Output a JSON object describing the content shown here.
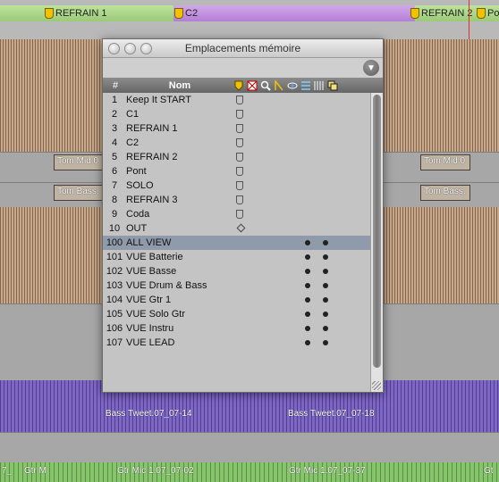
{
  "ruler": {
    "markers": [
      "REFRAIN 1",
      "C2",
      "REFRAIN 2",
      "Pon"
    ]
  },
  "tracks": {
    "clips": [
      "Tom Mid.0",
      "Tom Mid.0",
      "Tom Bass.",
      "Tom Bass."
    ],
    "bass_labels": [
      "Bass Tweet.07_07-14",
      "Bass Tweet.07_07-18"
    ],
    "gtr_labels": [
      "7_",
      "Gtr M",
      "Gtr Mic 1.07_07-02",
      "Gtr Mic 1.07_07-37",
      "Gt"
    ]
  },
  "window": {
    "title": "Emplacements mémoire",
    "columns": {
      "num": "#",
      "name": "Nom"
    },
    "memories": [
      {
        "num": "1",
        "name": "Keep It START",
        "marker": "shield"
      },
      {
        "num": "2",
        "name": "C1",
        "marker": "shield"
      },
      {
        "num": "3",
        "name": "REFRAIN 1",
        "marker": "shield"
      },
      {
        "num": "4",
        "name": "C2",
        "marker": "shield"
      },
      {
        "num": "5",
        "name": "REFRAIN 2",
        "marker": "shield"
      },
      {
        "num": "6",
        "name": "Pont",
        "marker": "shield"
      },
      {
        "num": "7",
        "name": "SOLO",
        "marker": "shield"
      },
      {
        "num": "8",
        "name": "REFRAIN 3",
        "marker": "shield"
      },
      {
        "num": "9",
        "name": "Coda",
        "marker": "shield"
      },
      {
        "num": "10",
        "name": "OUT",
        "marker": "diamond"
      },
      {
        "num": "100",
        "name": "ALL VIEW",
        "marker": "dots",
        "selected": true
      },
      {
        "num": "101",
        "name": "VUE Batterie",
        "marker": "dots"
      },
      {
        "num": "102",
        "name": "VUE Basse",
        "marker": "dots"
      },
      {
        "num": "103",
        "name": "VUE Drum & Bass",
        "marker": "dots"
      },
      {
        "num": "104",
        "name": "VUE Gtr 1",
        "marker": "dots"
      },
      {
        "num": "105",
        "name": "VUE Solo Gtr",
        "marker": "dots"
      },
      {
        "num": "106",
        "name": "VUE Instru",
        "marker": "dots"
      },
      {
        "num": "107",
        "name": "VUE LEAD",
        "marker": "dots"
      }
    ]
  }
}
